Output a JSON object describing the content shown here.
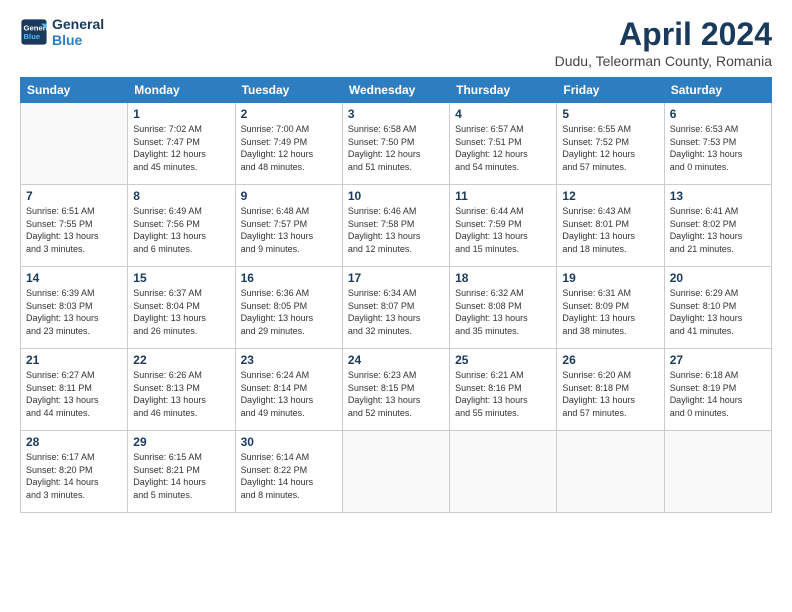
{
  "logo": {
    "line1": "General",
    "line2": "Blue"
  },
  "title": "April 2024",
  "location": "Dudu, Teleorman County, Romania",
  "days_of_week": [
    "Sunday",
    "Monday",
    "Tuesday",
    "Wednesday",
    "Thursday",
    "Friday",
    "Saturday"
  ],
  "weeks": [
    [
      {
        "day": "",
        "info": ""
      },
      {
        "day": "1",
        "info": "Sunrise: 7:02 AM\nSunset: 7:47 PM\nDaylight: 12 hours\nand 45 minutes."
      },
      {
        "day": "2",
        "info": "Sunrise: 7:00 AM\nSunset: 7:49 PM\nDaylight: 12 hours\nand 48 minutes."
      },
      {
        "day": "3",
        "info": "Sunrise: 6:58 AM\nSunset: 7:50 PM\nDaylight: 12 hours\nand 51 minutes."
      },
      {
        "day": "4",
        "info": "Sunrise: 6:57 AM\nSunset: 7:51 PM\nDaylight: 12 hours\nand 54 minutes."
      },
      {
        "day": "5",
        "info": "Sunrise: 6:55 AM\nSunset: 7:52 PM\nDaylight: 12 hours\nand 57 minutes."
      },
      {
        "day": "6",
        "info": "Sunrise: 6:53 AM\nSunset: 7:53 PM\nDaylight: 13 hours\nand 0 minutes."
      }
    ],
    [
      {
        "day": "7",
        "info": "Sunrise: 6:51 AM\nSunset: 7:55 PM\nDaylight: 13 hours\nand 3 minutes."
      },
      {
        "day": "8",
        "info": "Sunrise: 6:49 AM\nSunset: 7:56 PM\nDaylight: 13 hours\nand 6 minutes."
      },
      {
        "day": "9",
        "info": "Sunrise: 6:48 AM\nSunset: 7:57 PM\nDaylight: 13 hours\nand 9 minutes."
      },
      {
        "day": "10",
        "info": "Sunrise: 6:46 AM\nSunset: 7:58 PM\nDaylight: 13 hours\nand 12 minutes."
      },
      {
        "day": "11",
        "info": "Sunrise: 6:44 AM\nSunset: 7:59 PM\nDaylight: 13 hours\nand 15 minutes."
      },
      {
        "day": "12",
        "info": "Sunrise: 6:43 AM\nSunset: 8:01 PM\nDaylight: 13 hours\nand 18 minutes."
      },
      {
        "day": "13",
        "info": "Sunrise: 6:41 AM\nSunset: 8:02 PM\nDaylight: 13 hours\nand 21 minutes."
      }
    ],
    [
      {
        "day": "14",
        "info": "Sunrise: 6:39 AM\nSunset: 8:03 PM\nDaylight: 13 hours\nand 23 minutes."
      },
      {
        "day": "15",
        "info": "Sunrise: 6:37 AM\nSunset: 8:04 PM\nDaylight: 13 hours\nand 26 minutes."
      },
      {
        "day": "16",
        "info": "Sunrise: 6:36 AM\nSunset: 8:05 PM\nDaylight: 13 hours\nand 29 minutes."
      },
      {
        "day": "17",
        "info": "Sunrise: 6:34 AM\nSunset: 8:07 PM\nDaylight: 13 hours\nand 32 minutes."
      },
      {
        "day": "18",
        "info": "Sunrise: 6:32 AM\nSunset: 8:08 PM\nDaylight: 13 hours\nand 35 minutes."
      },
      {
        "day": "19",
        "info": "Sunrise: 6:31 AM\nSunset: 8:09 PM\nDaylight: 13 hours\nand 38 minutes."
      },
      {
        "day": "20",
        "info": "Sunrise: 6:29 AM\nSunset: 8:10 PM\nDaylight: 13 hours\nand 41 minutes."
      }
    ],
    [
      {
        "day": "21",
        "info": "Sunrise: 6:27 AM\nSunset: 8:11 PM\nDaylight: 13 hours\nand 44 minutes."
      },
      {
        "day": "22",
        "info": "Sunrise: 6:26 AM\nSunset: 8:13 PM\nDaylight: 13 hours\nand 46 minutes."
      },
      {
        "day": "23",
        "info": "Sunrise: 6:24 AM\nSunset: 8:14 PM\nDaylight: 13 hours\nand 49 minutes."
      },
      {
        "day": "24",
        "info": "Sunrise: 6:23 AM\nSunset: 8:15 PM\nDaylight: 13 hours\nand 52 minutes."
      },
      {
        "day": "25",
        "info": "Sunrise: 6:21 AM\nSunset: 8:16 PM\nDaylight: 13 hours\nand 55 minutes."
      },
      {
        "day": "26",
        "info": "Sunrise: 6:20 AM\nSunset: 8:18 PM\nDaylight: 13 hours\nand 57 minutes."
      },
      {
        "day": "27",
        "info": "Sunrise: 6:18 AM\nSunset: 8:19 PM\nDaylight: 14 hours\nand 0 minutes."
      }
    ],
    [
      {
        "day": "28",
        "info": "Sunrise: 6:17 AM\nSunset: 8:20 PM\nDaylight: 14 hours\nand 3 minutes."
      },
      {
        "day": "29",
        "info": "Sunrise: 6:15 AM\nSunset: 8:21 PM\nDaylight: 14 hours\nand 5 minutes."
      },
      {
        "day": "30",
        "info": "Sunrise: 6:14 AM\nSunset: 8:22 PM\nDaylight: 14 hours\nand 8 minutes."
      },
      {
        "day": "",
        "info": ""
      },
      {
        "day": "",
        "info": ""
      },
      {
        "day": "",
        "info": ""
      },
      {
        "day": "",
        "info": ""
      }
    ]
  ]
}
